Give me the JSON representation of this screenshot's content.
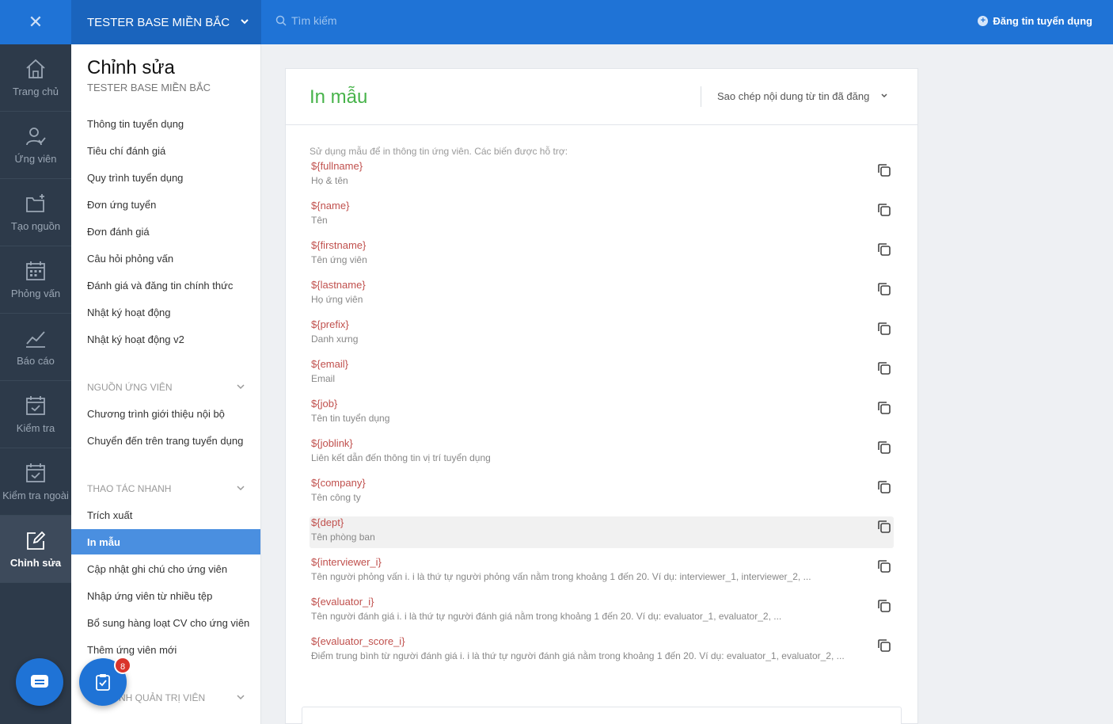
{
  "topbar": {
    "close_label": "✕",
    "company": "TESTER BASE MIỀN BẮC",
    "search_placeholder": "Tìm kiếm",
    "post_job_label": "Đăng tin tuyển dụng"
  },
  "rail": {
    "items": [
      {
        "label": "Trang chủ",
        "icon": "home-icon"
      },
      {
        "label": "Ứng viên",
        "icon": "user-check-icon"
      },
      {
        "label": "Tạo nguồn",
        "icon": "folder-plus-icon"
      },
      {
        "label": "Phỏng vấn",
        "icon": "calendar-icon"
      },
      {
        "label": "Báo cáo",
        "icon": "chart-line-icon"
      },
      {
        "label": "Kiểm tra",
        "icon": "calendar-check-icon"
      },
      {
        "label": "Kiểm tra ngoài",
        "icon": "calendar-check-icon"
      },
      {
        "label": "Chỉnh sửa",
        "icon": "edit-icon",
        "active": true
      }
    ]
  },
  "sidebar": {
    "title": "Chỉnh sửa",
    "subtitle": "TESTER BASE MIỀN BẮC",
    "links": [
      "Thông tin tuyển dụng",
      "Tiêu chí đánh giá",
      "Quy trình tuyển dụng",
      "Đơn ứng tuyển",
      "Đơn đánh giá",
      "Câu hỏi phỏng vấn",
      "Đánh giá và đăng tin chính thức",
      "Nhật ký hoạt động",
      "Nhật ký hoạt động v2"
    ],
    "section_sources": "NGUỒN ỨNG VIÊN",
    "source_links": [
      "Chương trình giới thiệu nội bộ",
      "Chuyển đến trên trang tuyển dụng"
    ],
    "section_quick": "THAO TÁC NHANH",
    "quick_links": [
      "Trích xuất",
      "In mẫu",
      "Cập nhật ghi chú cho ứng viên",
      "Nhập ứng viên từ nhiều tệp",
      "Bổ sung hàng loạt CV cho ứng viên",
      "Thêm ứng viên mới"
    ],
    "section_admin": "NH QUẢN TRỊ VIÊN"
  },
  "main": {
    "title": "In mẫu",
    "copy_from_label": "Sao chép nội dung từ tin đã đăng",
    "intro": "Sử dụng mẫu để in thông tin ứng viên. Các biến được hỗ trợ:",
    "variables": [
      {
        "name": "${fullname}",
        "desc": "Họ & tên"
      },
      {
        "name": "${name}",
        "desc": "Tên"
      },
      {
        "name": "${firstname}",
        "desc": "Tên ứng viên"
      },
      {
        "name": "${lastname}",
        "desc": "Họ ứng viên"
      },
      {
        "name": "${prefix}",
        "desc": "Danh xưng"
      },
      {
        "name": "${email}",
        "desc": "Email"
      },
      {
        "name": "${job}",
        "desc": "Tên tin tuyển dụng"
      },
      {
        "name": "${joblink}",
        "desc": "Liên kết dẫn đến thông tin vị trí tuyển dụng"
      },
      {
        "name": "${company}",
        "desc": "Tên công ty"
      },
      {
        "name": "${dept}",
        "desc": "Tên phòng ban",
        "highlighted": true
      },
      {
        "name": "${interviewer_i}",
        "desc": "Tên người phỏng vấn i. i là thứ tự người phỏng vấn nằm trong khoảng 1 đến 20. Ví dụ: interviewer_1, interviewer_2, ..."
      },
      {
        "name": "${evaluator_i}",
        "desc": "Tên người đánh giá i. i là thứ tự người đánh giá nằm trong khoảng 1 đến 20. Ví dụ: evaluator_1, evaluator_2, ..."
      },
      {
        "name": "${evaluator_score_i}",
        "desc": "Điểm trung bình từ người đánh giá i. i là thứ tự người đánh giá nằm trong khoảng 1 đến 20. Ví dụ: evaluator_1, evaluator_2, ..."
      }
    ]
  },
  "floating": {
    "task_badge": "8"
  },
  "colors": {
    "topbar": "#1f73d6",
    "rail": "#2d3a4a",
    "title_green": "#47b34a",
    "variable_red": "#c0504d",
    "active_item": "#4a8fe0"
  }
}
